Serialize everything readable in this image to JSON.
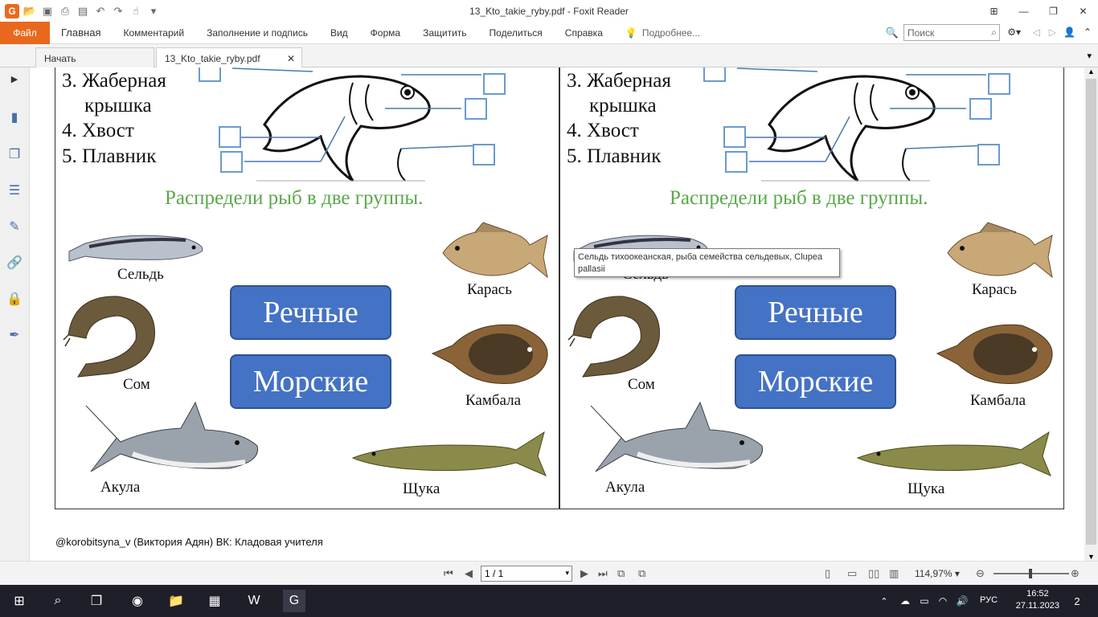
{
  "window": {
    "title": "13_Kto_takie_ryby.pdf - Foxit Reader"
  },
  "ribbon": {
    "file_tab": "Файл",
    "tabs": [
      "Главная",
      "Комментарий",
      "Заполнение и подпись",
      "Вид",
      "Форма",
      "Защитить",
      "Поделиться",
      "Справка"
    ],
    "tell_me": "Подробнее...",
    "search_placeholder": "Поиск"
  },
  "doc_tabs": {
    "start": "Начать",
    "file": "13_Kto_takie_ryby.pdf"
  },
  "page": {
    "parts": {
      "item3_line1": "3. Жаберная",
      "item3_line2": "крышка",
      "item4": "4. Хвост",
      "item5": "5. Плавник"
    },
    "heading": "Распредели рыб в две группы.",
    "buttons": {
      "river": "Речные",
      "sea": "Морские"
    },
    "fish": {
      "herring": "Сельдь",
      "crucian": "Карась",
      "catfish": "Сом",
      "flounder": "Камбала",
      "shark": "Акула",
      "pike": "Щука"
    }
  },
  "tooltip": {
    "text": "Сельдь тихоокеанская, рыба семейства сельдевых, Clupea pallasii"
  },
  "footer_note": "@korobitsyna_v (Виктория Адян)   ВК: Кладовая учителя",
  "statusbar": {
    "page_value": "1 / 1",
    "zoom": "114,97%"
  },
  "taskbar": {
    "lang": "РУС",
    "time": "16:52",
    "date": "27.11.2023",
    "notifications": "2"
  }
}
